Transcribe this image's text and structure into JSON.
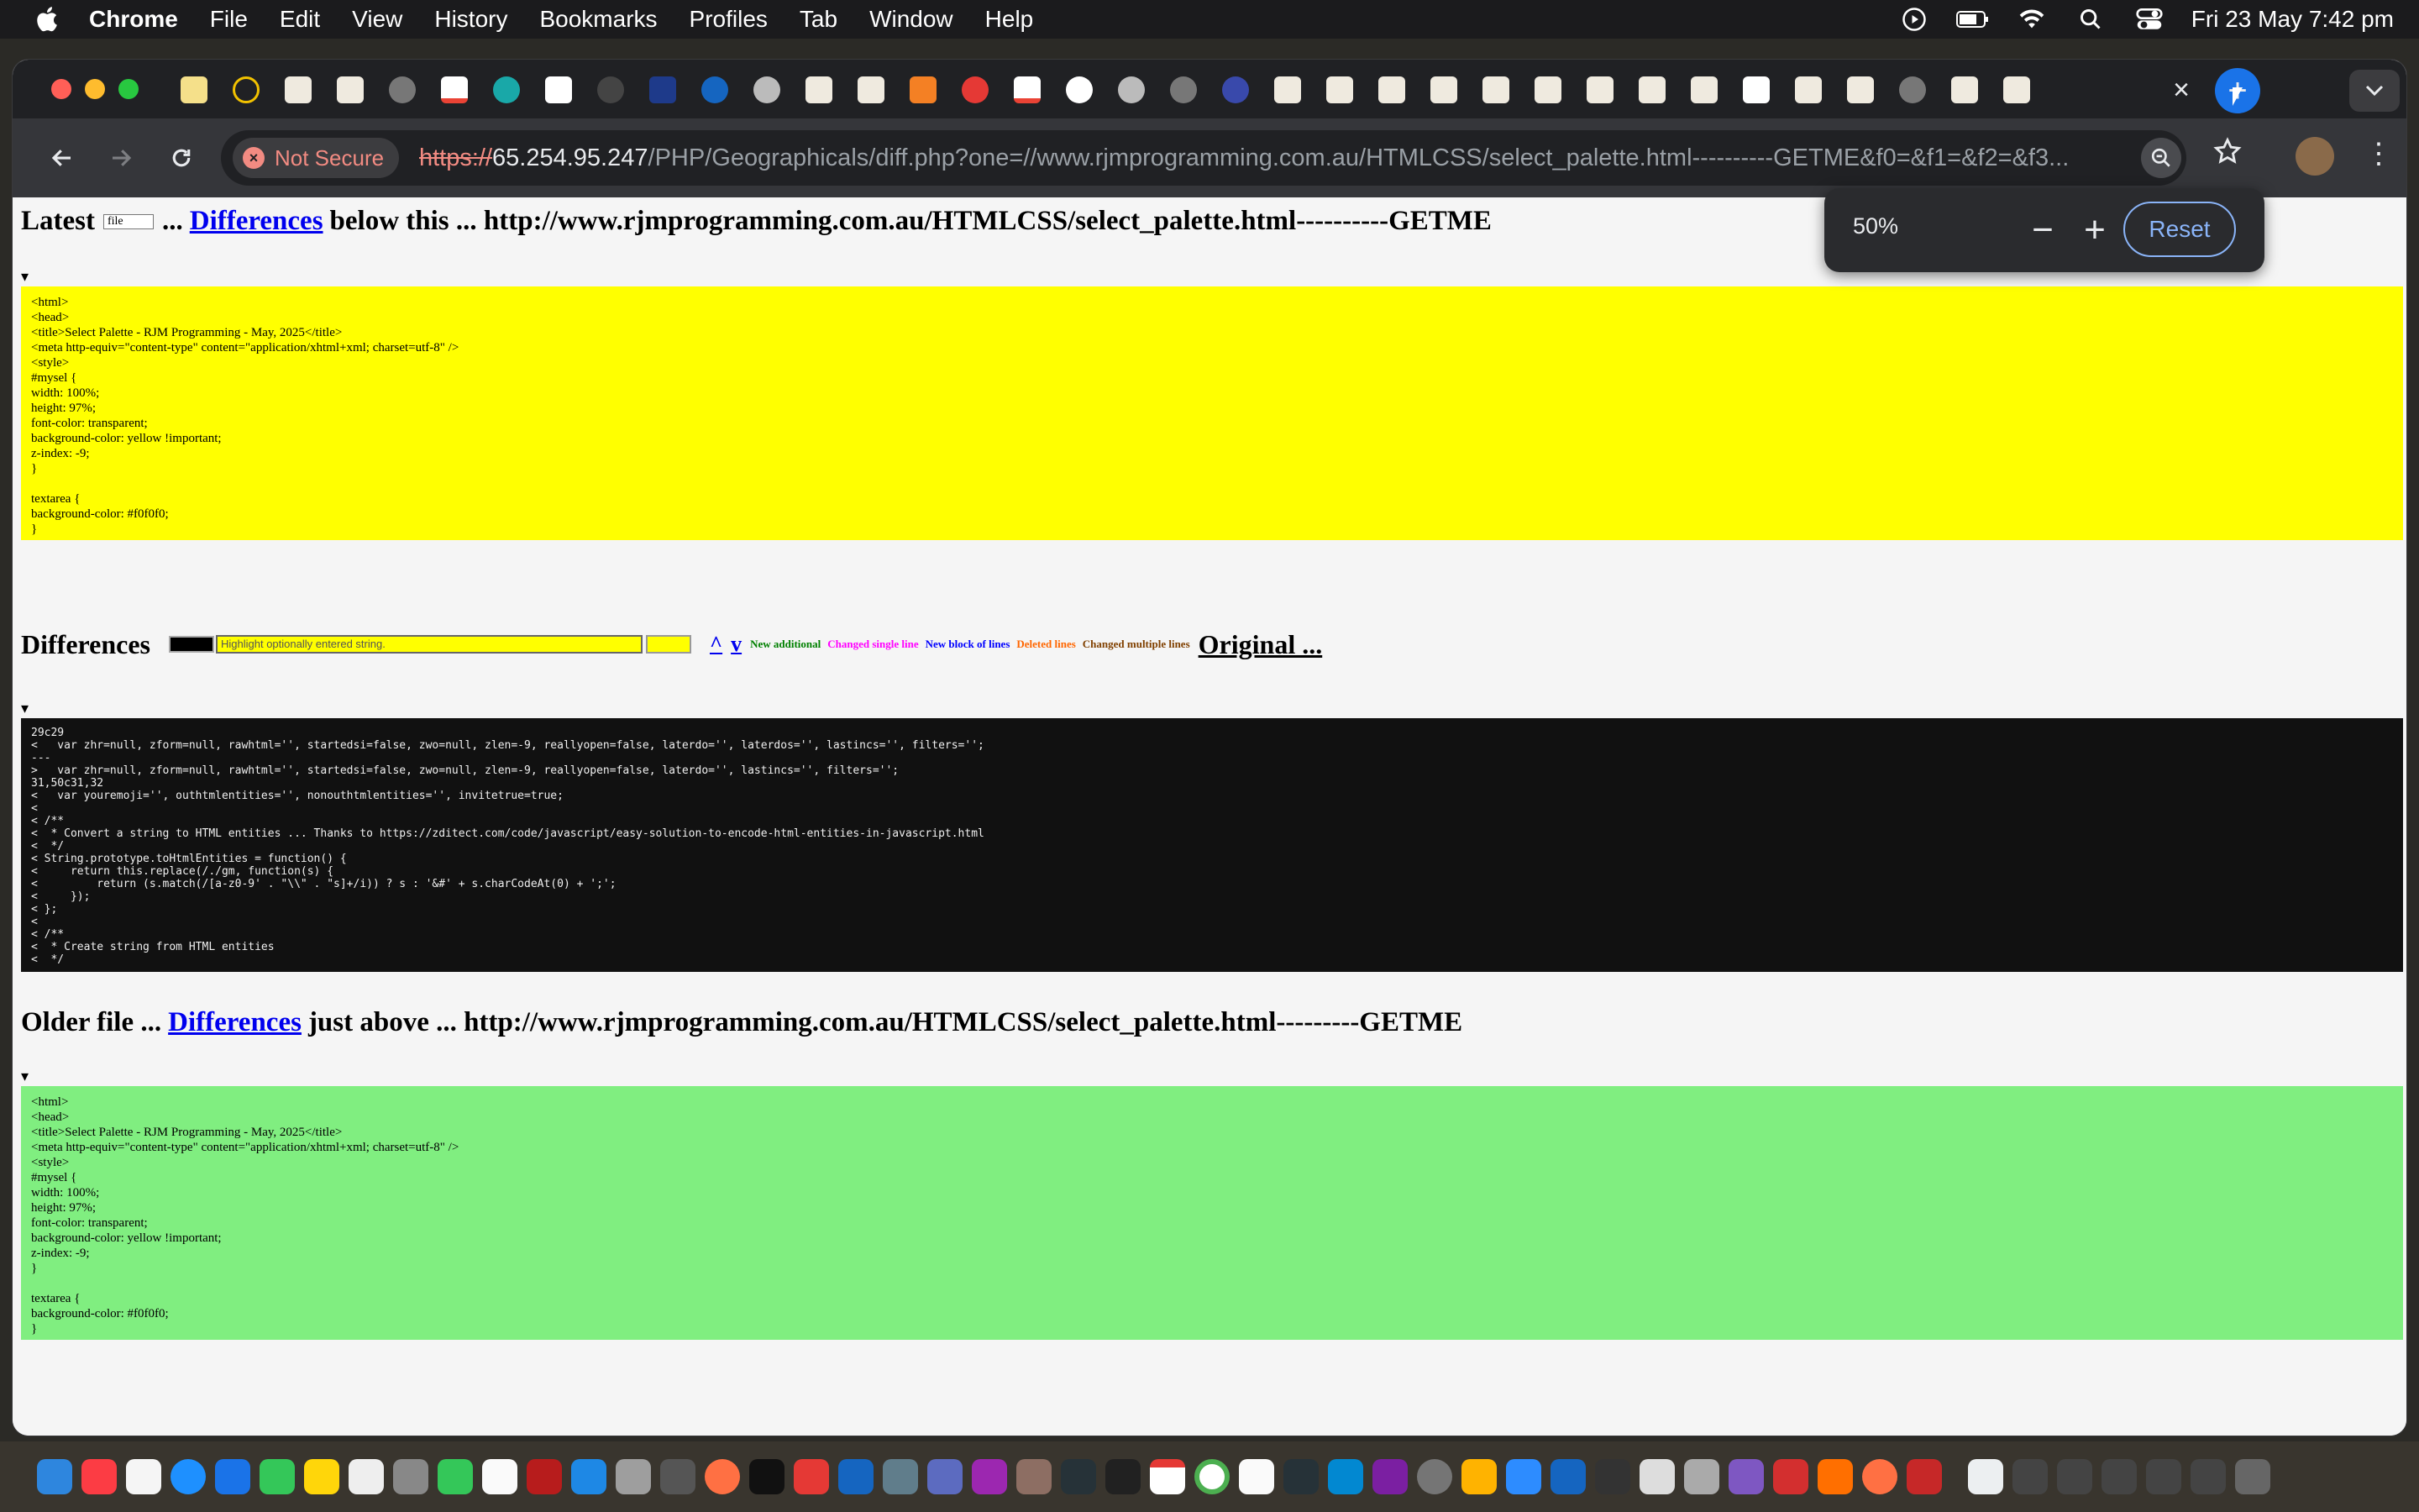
{
  "menubar": {
    "app_name": "Chrome",
    "items": [
      "File",
      "Edit",
      "View",
      "History",
      "Bookmarks",
      "Profiles",
      "Tab",
      "Window",
      "Help"
    ],
    "clock": "Fri 23 May  7:42 pm",
    "status_icons": [
      "play-circle-icon",
      "battery-icon",
      "wifi-icon",
      "search-icon",
      "control-center-icon"
    ]
  },
  "browser": {
    "tab_close": "×",
    "new_tab": "+",
    "security_label": "Not Secure",
    "url_scheme": "https://",
    "url_host": "65.254.95.247",
    "url_path": "/PHP/Geographicals/diff.php?one=//www.rjmprogramming.com.au/HTMLCSS/select_palette.html----------GETME&f0=&f1=&f2=&f3..."
  },
  "zoom_popup": {
    "level": "50%",
    "minus": "−",
    "plus": "+",
    "reset_label": "Reset"
  },
  "page": {
    "latest_heading": {
      "prefix": "Latest",
      "select_value": "file",
      "ellipsis": "...",
      "link": "Differences",
      "suffix": "below this ... http://www.rjmprogramming.com.au/HTMLCSS/select_palette.html----------GETME"
    },
    "disclosure": "▾",
    "latest_code": "<html>\n<head>\n<title>Select Palette - RJM Programming - May, 2025</title>\n<meta http-equiv=\"content-type\" content=\"application/xhtml+xml; charset=utf-8\" />\n<style>\n#mysel {\nwidth: 100%;\nheight: 97%;\nfont-color: transparent;\nbackground-color: yellow !important;\nz-index: -9;\n}\n\ntextarea {\nbackground-color: #f0f0f0;\n}",
    "differences_bar": {
      "title": "Differences",
      "highlight_placeholder": "Highlight optionally entered string.",
      "up_arrow": "^",
      "down_arrow": "v",
      "legend": [
        {
          "label": "New additional",
          "color": "#008000"
        },
        {
          "label": "Changed single line",
          "color": "#ff00ff"
        },
        {
          "label": "New block of lines",
          "color": "#0000ff"
        },
        {
          "label": "Deleted lines",
          "color": "#ff6600"
        },
        {
          "label": "Changed multiple lines",
          "color": "#804000"
        }
      ],
      "original_link": "Original ..."
    },
    "diff_code": "29c29\n<   var zhr=null, zform=null, rawhtml='', startedsi=false, zwo=null, zlen=-9, reallyopen=false, laterdo='', laterdos='', lastincs='', filters='';\n---\n>   var zhr=null, zform=null, rawhtml='', startedsi=false, zwo=null, zlen=-9, reallyopen=false, laterdo='', lastincs='', filters='';\n31,50c31,32\n<   var youremoji='', outhtmlentities='', nonouthtmlentities='', invitetrue=true;\n<\n< /**\n<  * Convert a string to HTML entities ... Thanks to https://zditect.com/code/javascript/easy-solution-to-encode-html-entities-in-javascript.html\n<  */\n< String.prototype.toHtmlEntities = function() {\n<     return this.replace(/./gm, function(s) {\n<         return (s.match(/[a-z0-9' . \"\\\\\" . \"s]+/i)) ? s : '&#' + s.charCodeAt(0) + ';';\n<     });\n< };\n<\n< /**\n<  * Create string from HTML entities\n<  */",
    "older_heading": {
      "prefix": "Older file ...",
      "link": "Differences",
      "suffix": "just above ... http://www.rjmprogramming.com.au/HTMLCSS/select_palette.html---------GETME"
    },
    "older_code": "<html>\n<head>\n<title>Select Palette - RJM Programming - May, 2025</title>\n<meta http-equiv=\"content-type\" content=\"application/xhtml+xml; charset=utf-8\" />\n<style>\n#mysel {\nwidth: 100%;\nheight: 97%;\nfont-color: transparent;\nbackground-color: yellow !important;\nz-index: -9;\n}\n\ntextarea {\nbackground-color: #f0f0f0;\n}"
  },
  "colors": {
    "latest_box": "#ffff00",
    "older_box": "#80ee80",
    "diff_box": "#111111",
    "link": "#0000ee",
    "not_secure": "#f28b82",
    "reset_button": "#8ab4f8"
  }
}
